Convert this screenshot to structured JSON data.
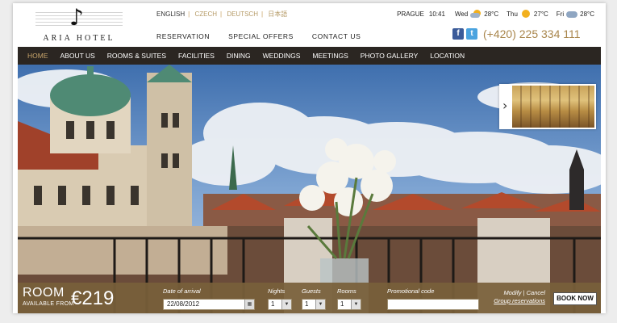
{
  "logo": {
    "name": "ARIA HOTEL",
    "icon": "music-note-icon"
  },
  "languages": [
    {
      "label": "ENGLISH",
      "active": true
    },
    {
      "label": "CZECH",
      "active": false
    },
    {
      "label": "DEUTSCH",
      "active": false
    },
    {
      "label": "日本語",
      "active": false
    }
  ],
  "top_nav": [
    "RESERVATION",
    "SPECIAL OFFERS",
    "CONTACT US"
  ],
  "weather": {
    "city": "PRAGUE",
    "time": "10:41",
    "days": [
      {
        "day": "Wed",
        "temp": "28°C",
        "icon": "partly-cloudy-icon"
      },
      {
        "day": "Thu",
        "temp": "27°C",
        "icon": "sun-icon"
      },
      {
        "day": "Fri",
        "temp": "28°C",
        "icon": "cloud-icon"
      }
    ]
  },
  "social": {
    "facebook": "f",
    "twitter": "t"
  },
  "phone": "(+420) 225 334 111",
  "main_nav": [
    "HOME",
    "ABOUT US",
    "ROOMS & SUITES",
    "FACILITIES",
    "DINING",
    "WEDDINGS",
    "MEETINGS",
    "PHOTO GALLERY",
    "LOCATION"
  ],
  "thumb": {
    "arrow": "›",
    "icon": "chevron-right-icon"
  },
  "booking": {
    "room_label": "ROOM",
    "from_label": "AVAILABLE FROM",
    "price": "€219",
    "date_label": "Date of arrival",
    "date_value": "22/08/2012",
    "nights_label": "Nights",
    "nights_value": "1",
    "guests_label": "Guests",
    "guests_value": "1",
    "rooms_label": "Rooms",
    "rooms_value": "1",
    "promo_label": "Promotional code",
    "promo_value": "",
    "modify_link": "Modify | Cancel",
    "group_link": "Group reservations",
    "book_button": "BOOK NOW"
  },
  "colors": {
    "accent": "#a9864c",
    "nav_bg": "#2b2622",
    "booking_bg": "#78603a"
  }
}
